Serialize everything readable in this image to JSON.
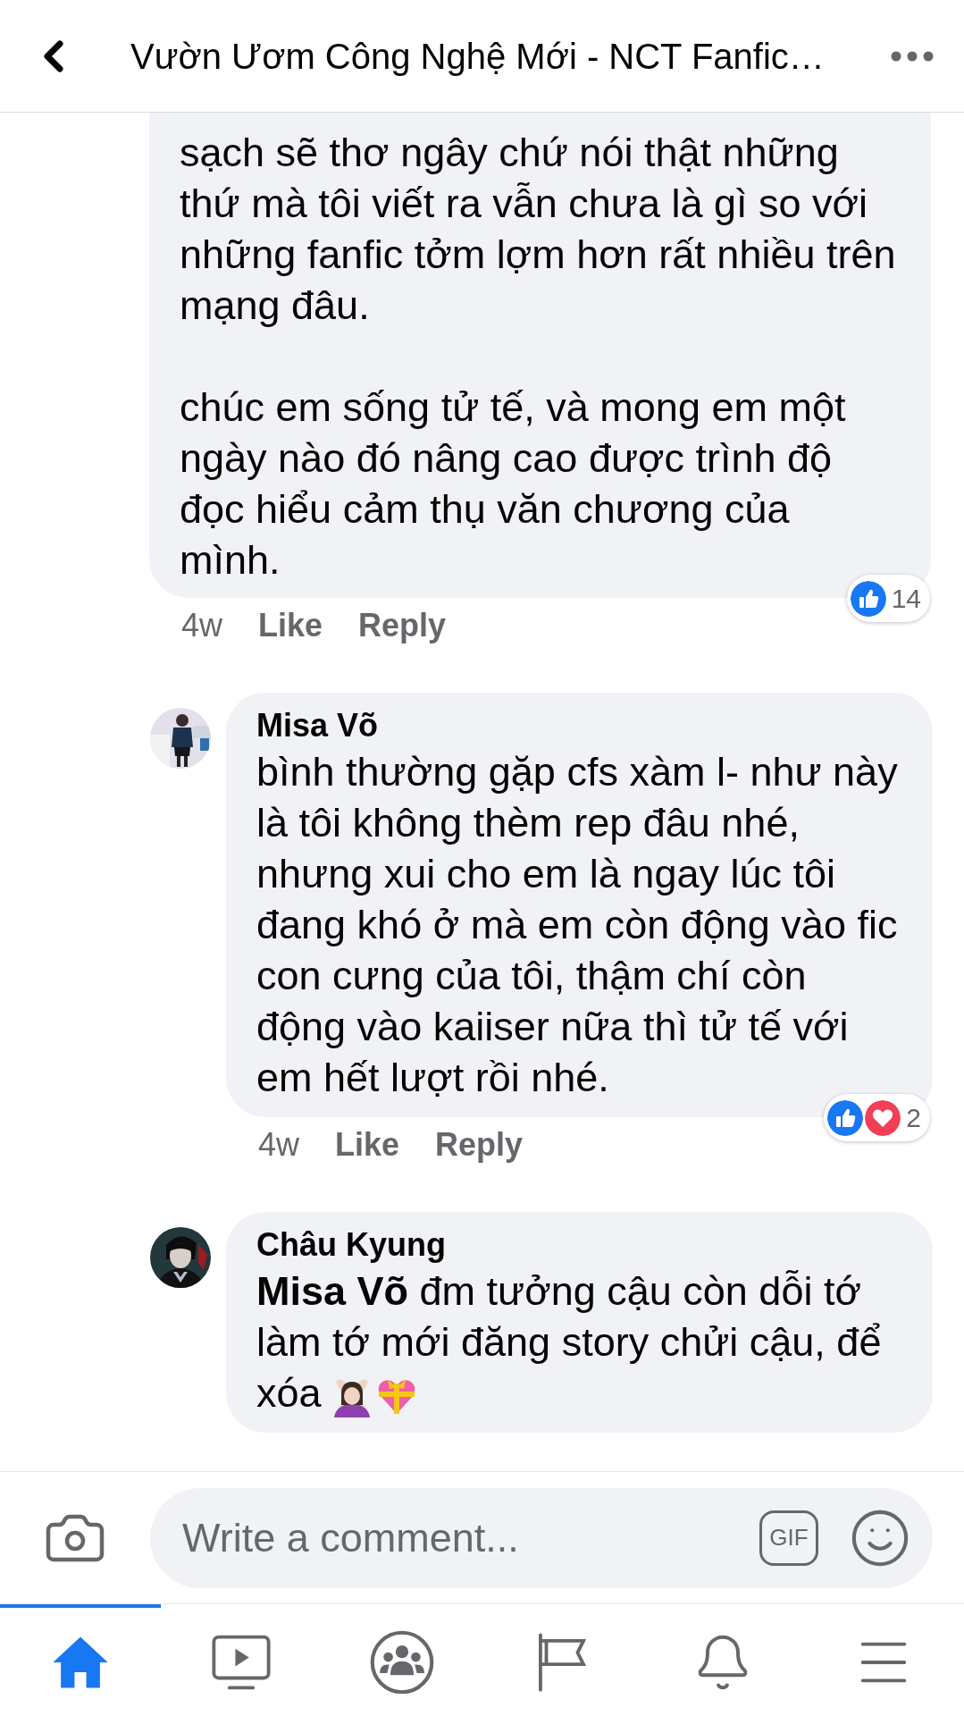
{
  "header": {
    "title": "Vườn Ươm Công Nghệ Mới - NCT Fanfic…"
  },
  "comments": [
    {
      "paragraphs": [
        "sạch sẽ thơ ngây chứ nói thật những thứ mà tôi viết ra vẫn chưa là gì so với những fanfic tởm lợm hơn rất nhiều trên mạng đâu.",
        "chúc em sống tử tế, và mong em một ngày nào đó nâng cao được trình độ đọc hiểu cảm thụ văn chương của mình."
      ],
      "time": "4w",
      "like": "Like",
      "reply": "Reply",
      "reactions": [
        {
          "kind": "like"
        }
      ],
      "reaction_count": "14"
    },
    {
      "author": "Misa Võ",
      "avatar": {
        "kind": "picture"
      },
      "paragraphs": [
        "bình thường gặp cfs xàm l- như này là tôi không thèm rep đâu nhé, nhưng xui cho em là ngay lúc tôi đang khó ở mà em còn động vào fic con cưng của tôi, thậm chí còn động vào kaiiser nữa thì tử tế với em hết lượt rồi nhé."
      ],
      "time": "4w",
      "like": "Like",
      "reply": "Reply",
      "reactions": [
        {
          "kind": "like"
        },
        {
          "kind": "love"
        }
      ],
      "reaction_count": "2"
    },
    {
      "author": "Châu Kyung",
      "avatar": {
        "kind": "picture"
      },
      "paragraphs": [
        "**Misa Võ** đm tưởng cậu còn dỗi tớ làm tớ mới đăng story chửi cậu, để xóa"
      ],
      "emojis": [
        {
          "kind": "gesture"
        },
        {
          "kind": "gift-heart"
        }
      ]
    }
  ],
  "composer": {
    "placeholder": "Write a comment...",
    "gif": "GIF"
  },
  "nav": [
    {
      "kind": "home",
      "selected": true
    },
    {
      "kind": "video",
      "selected": false
    },
    {
      "kind": "groups",
      "selected": false
    },
    {
      "kind": "pages",
      "selected": false
    },
    {
      "kind": "notifications",
      "selected": false
    },
    {
      "kind": "menu",
      "selected": false
    }
  ]
}
